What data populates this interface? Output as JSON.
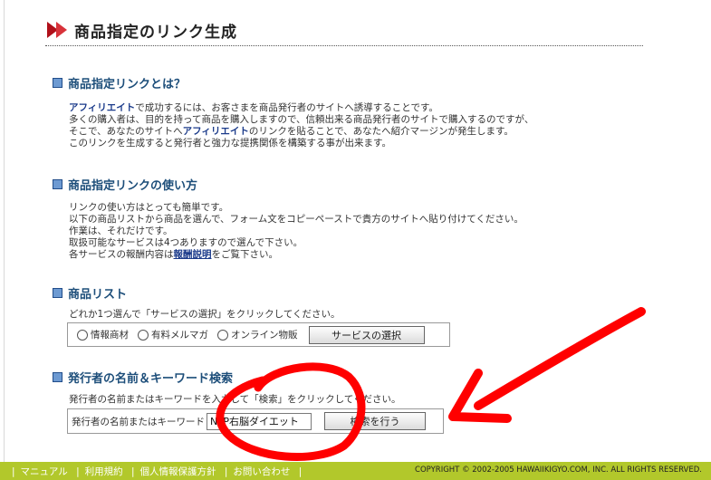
{
  "title": "商品指定のリンク生成",
  "sections": {
    "about": {
      "heading": "商品指定リンクとは？",
      "l1_b": "アフィリエイト",
      "l1": "で成功するには、お客さまを商品発行者のサイトへ誘導することです。",
      "l2": "多くの購入者は、目的を持って商品を購入しますので、信頼出来る商品発行者のサイトで購入するのですが、",
      "l3a": "そこで、あなたのサイトへ",
      "l3_b": "アフィリエイト",
      "l3c": "のリンクを貼ることで、あなたへ紹介マージンが発生します。",
      "l4": "このリンクを生成すると発行者と強力な提携関係を構築する事が出来ます。"
    },
    "usage": {
      "heading": "商品指定リンクの使い方",
      "l1": "リンクの使い方はとっても簡単です。",
      "l2": "以下の商品リストから商品を選んで、フォーム文をコピーペーストで貴方のサイトへ貼り付けてください。",
      "l3": "作業は、それだけです。",
      "l4": "取扱可能なサービスは4つありますので選んで下さい。",
      "l5a": "各サービスの報酬内容は",
      "l5_link": "報酬説明",
      "l5c": "をご覧下さい。"
    },
    "products": {
      "heading": "商品リスト",
      "instruction": "どれか1つ選んで「サービスの選択」をクリックしてください。",
      "options": [
        "情報商材",
        "有料メルマガ",
        "オンライン物販"
      ],
      "button": "サービスの選択"
    },
    "search": {
      "heading": "発行者の名前＆キーワード検索",
      "instruction": "発行者の名前またはキーワードを入力して「検索」をクリックしてください。",
      "label": "発行者の名前またはキーワード",
      "value": "NLP右脳ダイエット",
      "button": "検索を行う"
    }
  },
  "footer": {
    "links": [
      "マニュアル",
      "利用規約",
      "個人情報保護方針",
      "お問い合わせ"
    ],
    "copyright": "COPYRIGHT © 2002-2005 HAWAIIKIGYO.COM, INC. ALL RIGHTS RESERVED."
  },
  "colors": {
    "accent": "#b0101a",
    "heading": "#1d4e7a",
    "footer": "#b2c82b",
    "annotation": "#ff0000"
  }
}
